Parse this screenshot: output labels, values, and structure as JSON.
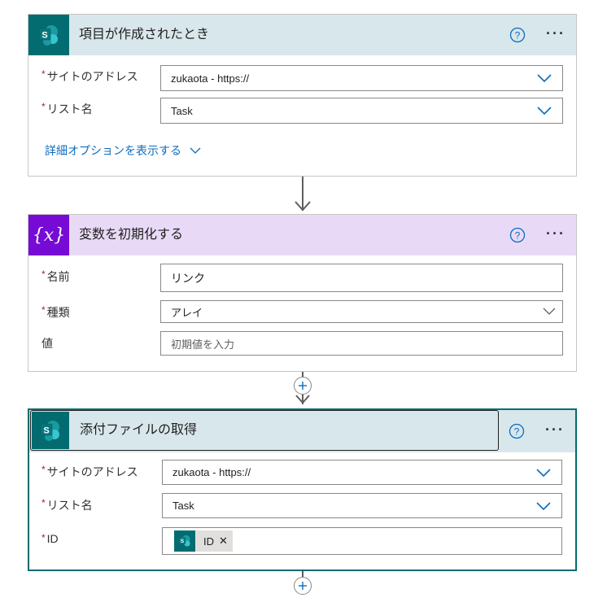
{
  "card1": {
    "title": "項目が作成されたとき",
    "site_label": "サイトのアドレス",
    "site_value": "zukaota - https://",
    "list_label": "リスト名",
    "list_value": "Task",
    "advanced_link": "詳細オプションを表示する",
    "more": "···"
  },
  "card2": {
    "title": "変数を初期化する",
    "name_label": "名前",
    "name_value": "リンク",
    "type_label": "種類",
    "type_value": "アレイ",
    "value_label": "値",
    "value_placeholder": "初期値を入力",
    "icon_glyph": "{x}",
    "more": "···"
  },
  "card3": {
    "title": "添付ファイルの取得",
    "site_label": "サイトのアドレス",
    "site_value": "zukaota - https://",
    "list_label": "リスト名",
    "list_value": "Task",
    "id_label": "ID",
    "id_token": "ID",
    "more": "···"
  },
  "required_mark": "*",
  "colors": {
    "sharepoint_teal": "#036c70",
    "sp_header_bg": "#d8e7ec",
    "variable_purple": "#770bd6",
    "variable_header_bg": "#e8daf7",
    "link_blue": "#0f6cbd"
  },
  "icons": [
    "sharepoint-logo-icon",
    "variable-icon",
    "help-icon",
    "more-icon",
    "chevron-down-icon",
    "plus-icon",
    "arrow-down-icon",
    "remove-token-icon"
  ]
}
